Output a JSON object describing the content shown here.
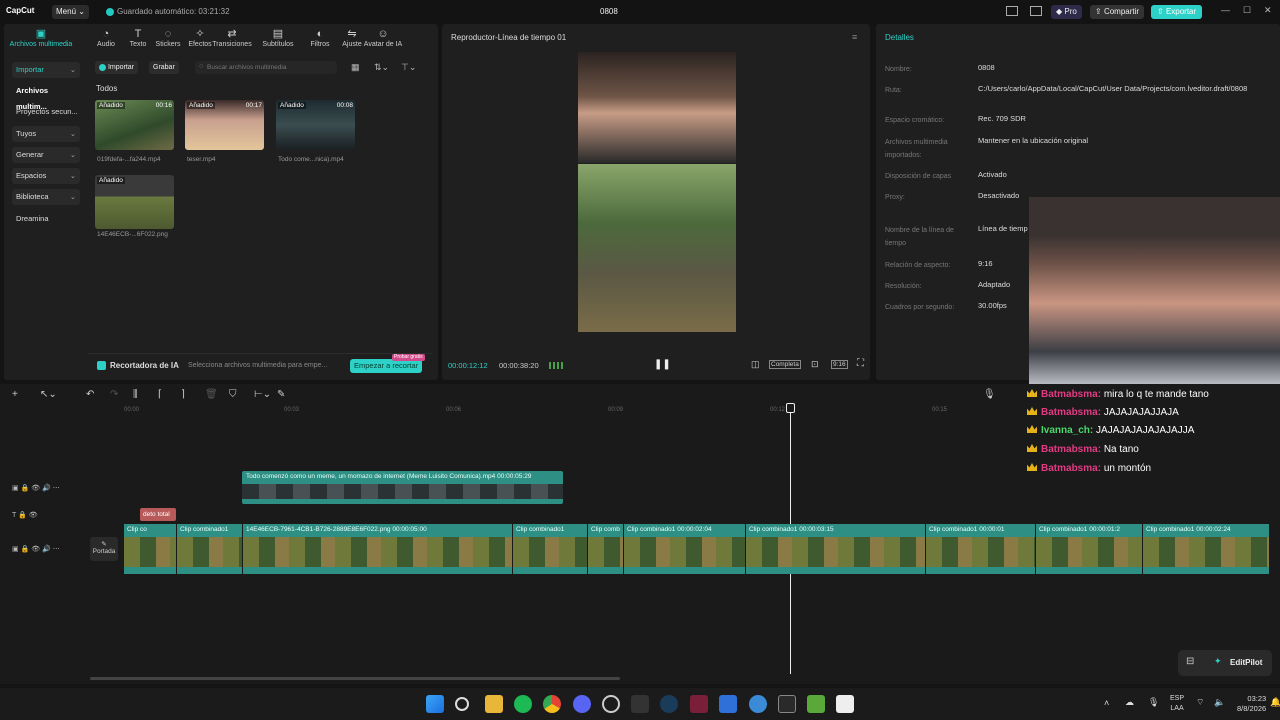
{
  "titlebar": {
    "logo": "CapCut",
    "menu_label": "Menú",
    "autosave": "Guardado automático: 03:21:32",
    "project_title": "0808",
    "pro_label": "Pro",
    "share_label": "Compartir",
    "export_label": "Exportar"
  },
  "toolbar": [
    {
      "label": "Archivos multimedia",
      "icon": "media-icon"
    },
    {
      "label": "Audio",
      "icon": "audio-icon"
    },
    {
      "label": "Texto",
      "icon": "text-icon"
    },
    {
      "label": "Stickers",
      "icon": "sticker-icon"
    },
    {
      "label": "Efectos",
      "icon": "effects-icon"
    },
    {
      "label": "Transiciones",
      "icon": "transitions-icon"
    },
    {
      "label": "Subtítulos",
      "icon": "subtitles-icon"
    },
    {
      "label": "Filtros",
      "icon": "filters-icon"
    },
    {
      "label": "Ajuste",
      "icon": "adjust-icon"
    },
    {
      "label": "Avatar de IA",
      "icon": "avatar-icon"
    }
  ],
  "sidebar": {
    "items": [
      "Importar",
      "Archivos multim...",
      "Proyectos secun...",
      "Tuyos",
      "Generar",
      "Espacios",
      "Biblioteca",
      "Dreamina"
    ]
  },
  "media": {
    "import_label": "Importar",
    "record_label": "Grabar",
    "search_placeholder": "Buscar archivos multimedia",
    "section_label": "Todos",
    "items": [
      {
        "badge": "Añadido",
        "duration": "00:16",
        "name": "019fdefa-...fa244.mp4"
      },
      {
        "badge": "Añadido",
        "duration": "00:17",
        "name": "teser.mp4"
      },
      {
        "badge": "Añadido",
        "duration": "00:08",
        "name": "Todo come...nica).mp4"
      },
      {
        "badge": "Añadido",
        "duration": "",
        "name": "14E46ECB-...6F022.png"
      }
    ],
    "ai_cutter_label": "Recortadora de IA",
    "ai_cutter_hint": "Selecciona archivos multimedia para empe...",
    "start_cut_label": "Empezar a recortar",
    "promo_badge": "Probar gratis"
  },
  "player": {
    "title": "Reproductor-Línea de tiempo 01",
    "current_time": "00:00:12:12",
    "total_time": "00:00:38:20",
    "full_label": "Completa",
    "ratio_label": "9:16"
  },
  "details": {
    "title": "Detalles",
    "rows": [
      {
        "label": "Nombre:",
        "value": "0808"
      },
      {
        "label": "Ruta:",
        "value": "C:/Users/carlo/AppData/Local/CapCut/User Data/Projects/com.lveditor.draft/0808"
      },
      {
        "label": "Espacio cromático:",
        "value": "Rec. 709 SDR"
      },
      {
        "label": "Archivos multimedia importados:",
        "value": "Mantener en la ubicación original"
      },
      {
        "label": "Disposición de capas",
        "value": "Activado"
      },
      {
        "label": "Proxy:",
        "value": "Desactivado"
      },
      {
        "label": "Nombre de la línea de tiempo",
        "value": "Línea de tiemp"
      },
      {
        "label": "Relación de aspecto:",
        "value": "9:16"
      },
      {
        "label": "Resolución:",
        "value": "Adaptado"
      },
      {
        "label": "Cuadros por segundo:",
        "value": "30.00fps"
      }
    ]
  },
  "timeline": {
    "ruler": [
      "00:00",
      "00:03",
      "00:06",
      "00:09",
      "00:12",
      "00:15"
    ],
    "overlay_clip": "Todo comenzó como un meme, un momazo de internet (Meme Luisito Comunica).mp4  00:00:05:29",
    "text_clip": "deto total",
    "cover_label": "Portada",
    "main_clips": [
      "Clip co",
      "Clip combinado1",
      "14E46ECB-7961-4CB1-B726-2889E8E6F022.png  00:00:05:00",
      "Clip combinado1",
      "Clip comb",
      "Clip combinado1  00:00:02:04",
      "Clip combinado1  00:00:03:15",
      "Clip combinado1  00:00:01",
      "Clip combinado1  00:00:01:2",
      "Clip combinado1  00:00:02:24"
    ]
  },
  "chat": [
    {
      "name": "Batmabsma:",
      "msg": "mira lo q te mande tano",
      "green": false
    },
    {
      "name": "Batmabsma:",
      "msg": "JAJAJAJAJJAJA",
      "green": false
    },
    {
      "name": "Ivanna_ch:",
      "msg": "JAJAJAJAJAJAJAJJA",
      "green": true
    },
    {
      "name": "Batmabsma:",
      "msg": "Na tano",
      "green": false
    },
    {
      "name": "Batmabsma:",
      "msg": "un montón",
      "green": false
    }
  ],
  "editpilot_label": "EditPilot",
  "taskbar": {
    "lang_top": "ESP",
    "lang_bottom": "LAA",
    "time": "03:23",
    "date": "8/8/2026"
  }
}
